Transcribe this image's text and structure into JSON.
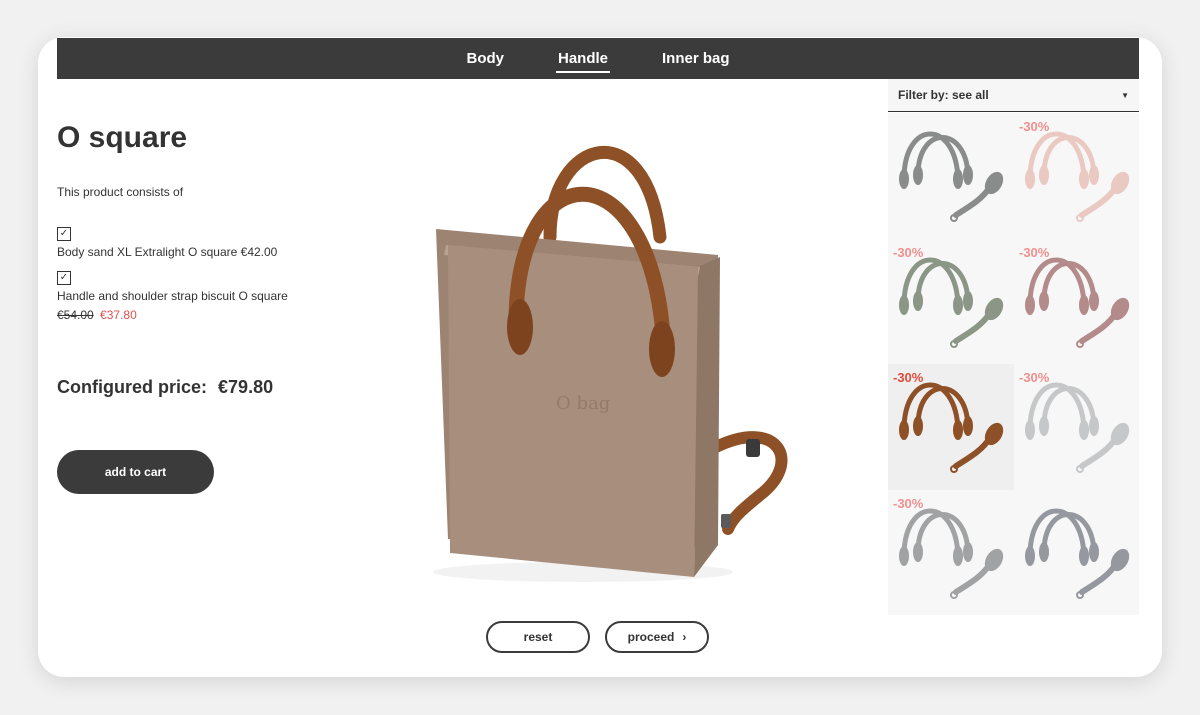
{
  "nav": {
    "tabs": [
      {
        "label": "Body"
      },
      {
        "label": "Handle",
        "active": true
      },
      {
        "label": "Inner bag"
      }
    ]
  },
  "product": {
    "title": "O square",
    "consists_label": "This product consists of",
    "items": [
      {
        "label": "Body sand XL Extralight O square €42.00",
        "checked": true
      },
      {
        "label": "Handle and shoulder strap biscuit O square",
        "checked": true,
        "old_price": "€54.00",
        "new_price": "€37.80"
      }
    ],
    "configured_label": "Configured price:",
    "configured_value": "€79.80",
    "add_to_cart": "add to cart",
    "bag_logo": "O bag",
    "colors": {
      "body": "#a88f7d",
      "handle": "#8e5026"
    }
  },
  "actions": {
    "reset": "reset",
    "proceed": "proceed"
  },
  "filter": {
    "label": "Filter by: see all"
  },
  "handles": [
    {
      "badge": "",
      "color": "#8a8c8c"
    },
    {
      "badge": "-30%",
      "color": "#e9c9c1"
    },
    {
      "badge": "-30%",
      "color": "#8b9686"
    },
    {
      "badge": "-30%",
      "color": "#b38b8a"
    },
    {
      "badge": "-30%",
      "color": "#8e5026",
      "selected": true
    },
    {
      "badge": "-30%",
      "color": "#c6c7c8"
    },
    {
      "badge": "-30%",
      "color": "#a1a2a3"
    },
    {
      "badge": "",
      "color": "#9698a0"
    }
  ]
}
